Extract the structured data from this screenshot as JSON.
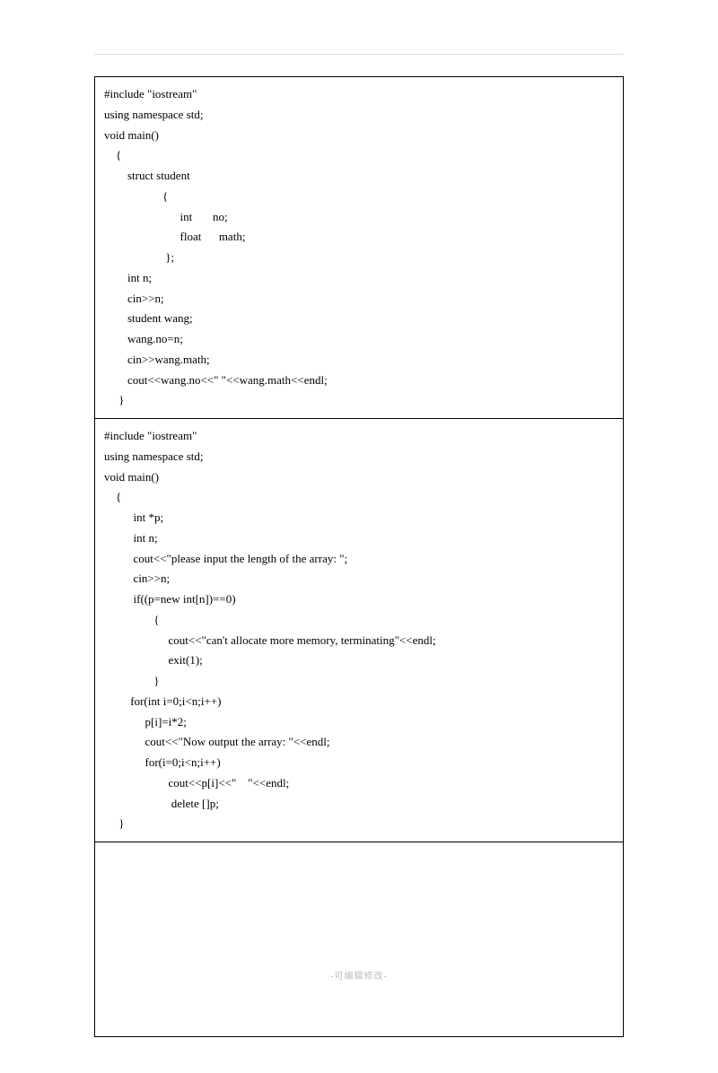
{
  "footer": "-可编辑修改-",
  "cells": [
    {
      "lines": [
        "#include \"iostream\"",
        "using namespace std;",
        "void main()",
        "    {",
        "        struct student",
        "                    {",
        "                          int       no;",
        "                          float      math;",
        "                     };",
        "        int n;",
        "        cin>>n;",
        "        student wang;",
        "        wang.no=n;",
        "        cin>>wang.math;",
        "        cout<<wang.no<<\" \"<<wang.math<<endl;",
        "     }"
      ]
    },
    {
      "lines": [
        "#include \"iostream\"",
        "using namespace std;",
        "void main()",
        "    {",
        "          int *p;",
        "          int n;",
        "          cout<<\"please input the length of the array: \";",
        "          cin>>n;",
        "          if((p=new int[n])==0)",
        "                 {",
        "                      cout<<\"can't allocate more memory, terminating\"<<endl;",
        "                      exit(1);",
        "                 }",
        "         for(int i=0;i<n;i++)",
        "              p[i]=i*2;",
        "              cout<<\"Now output the array: \"<<endl;",
        "              for(i=0;i<n;i++)",
        "                      cout<<p[i]<<\"    \"<<endl;",
        "                       delete []p;",
        "     }"
      ]
    },
    {
      "lines": []
    }
  ]
}
